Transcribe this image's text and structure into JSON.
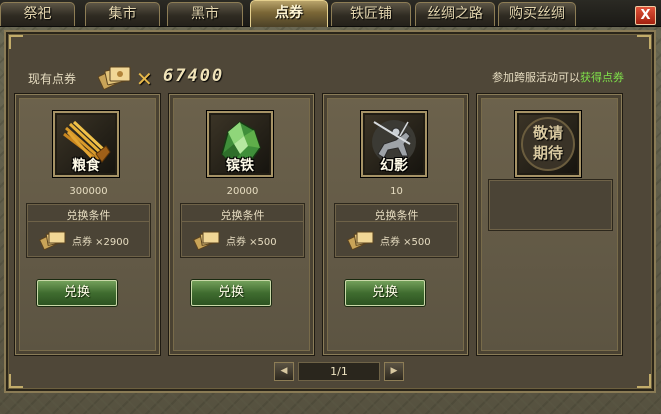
{
  "tabs": [
    {
      "label": "祭祀",
      "active": false
    },
    {
      "label": "集市",
      "active": false
    },
    {
      "label": "黑市",
      "active": false
    },
    {
      "label": "点券",
      "active": true
    },
    {
      "label": "铁匠铺",
      "active": false
    },
    {
      "label": "丝绸之路",
      "active": false
    },
    {
      "label": "购买丝绸",
      "active": false
    }
  ],
  "close_button": {
    "label": "X",
    "icon": "close-icon"
  },
  "coupon": {
    "label": "现有点券",
    "amount": "67400",
    "icon": "coupon-icon",
    "multiplier_icon": "times-icon"
  },
  "promo": {
    "text": "参加跨服活动可以",
    "link": "获得点券"
  },
  "cards": [
    {
      "name": "粮食",
      "qty": "300000",
      "icon": "grain-icon",
      "cond_title": "兑换条件",
      "cost": "点券 ×2900",
      "button": "兑换"
    },
    {
      "name": "镔铁",
      "qty": "20000",
      "icon": "iron-ore-icon",
      "cond_title": "兑换条件",
      "cost": "点券 ×500",
      "button": "兑换"
    },
    {
      "name": "幻影",
      "qty": "10",
      "icon": "cavalry-icon",
      "cond_title": "兑换条件",
      "cost": "点券 ×500",
      "button": "兑换"
    },
    {
      "name": "敬请\n期待",
      "icon": "coming-soon-icon"
    }
  ],
  "pager": {
    "text": "1/1",
    "prev_icon": "prev-arrow-icon",
    "next_icon": "next-arrow-icon"
  },
  "colors": {
    "panel": "#4f4738",
    "gold": "#c2ac6a",
    "button_green": "#3f6c2f",
    "link_green": "#7fe24a",
    "close_red": "#a3200f"
  }
}
